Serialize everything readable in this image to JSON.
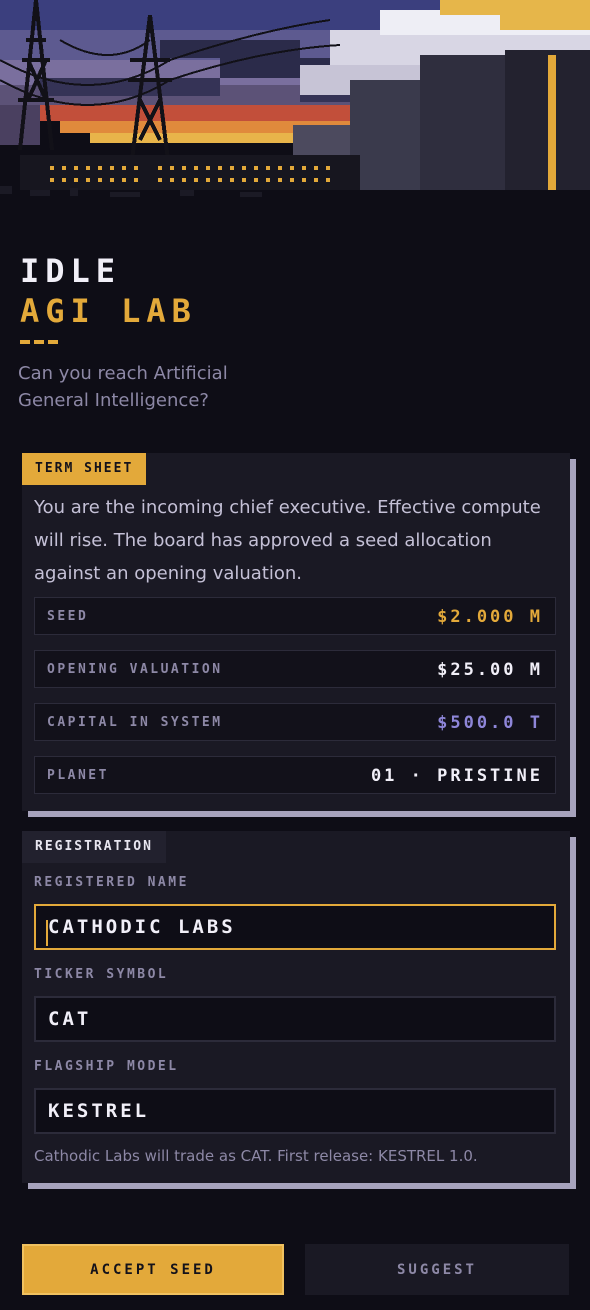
{
  "header": {
    "title_line1": "IDLE",
    "title_line2": "AGI LAB",
    "subtitle": "Can you reach Artificial General Intelligence?"
  },
  "term_sheet": {
    "tab_label": "TERM SHEET",
    "body": "You are the incoming chief executive. Effective compute will rise. The board has approved a seed allocation against an opening valuation.",
    "rows": [
      {
        "label": "SEED",
        "value": "$2.000 M",
        "color": "#e3a93a"
      },
      {
        "label": "OPENING VALUATION",
        "value": "$25.00 M",
        "color": "#f1eff8"
      },
      {
        "label": "CAPITAL IN SYSTEM",
        "value": "$500.0 T",
        "color": "#8e86d9"
      },
      {
        "label": "PLANET",
        "value": "01 · PRISTINE",
        "color": "#f1eff8"
      }
    ]
  },
  "registration": {
    "tab_label": "REGISTRATION",
    "name_label": "REGISTERED NAME",
    "name_value": "CATHODIC LABS",
    "ticker_label": "TICKER SYMBOL",
    "ticker_value": "CAT",
    "model_label": "FLAGSHIP MODEL",
    "model_value": "KESTREL",
    "hint": "Cathodic Labs will trade as CAT. First release: KESTREL 1.0."
  },
  "actions": {
    "accept_label": "ACCEPT SEED",
    "suggest_label": "SUGGEST"
  },
  "colors": {
    "accent": "#e3a93a",
    "background": "#0e0d16",
    "panel": "#1a1924",
    "muted": "#8d88a6"
  }
}
